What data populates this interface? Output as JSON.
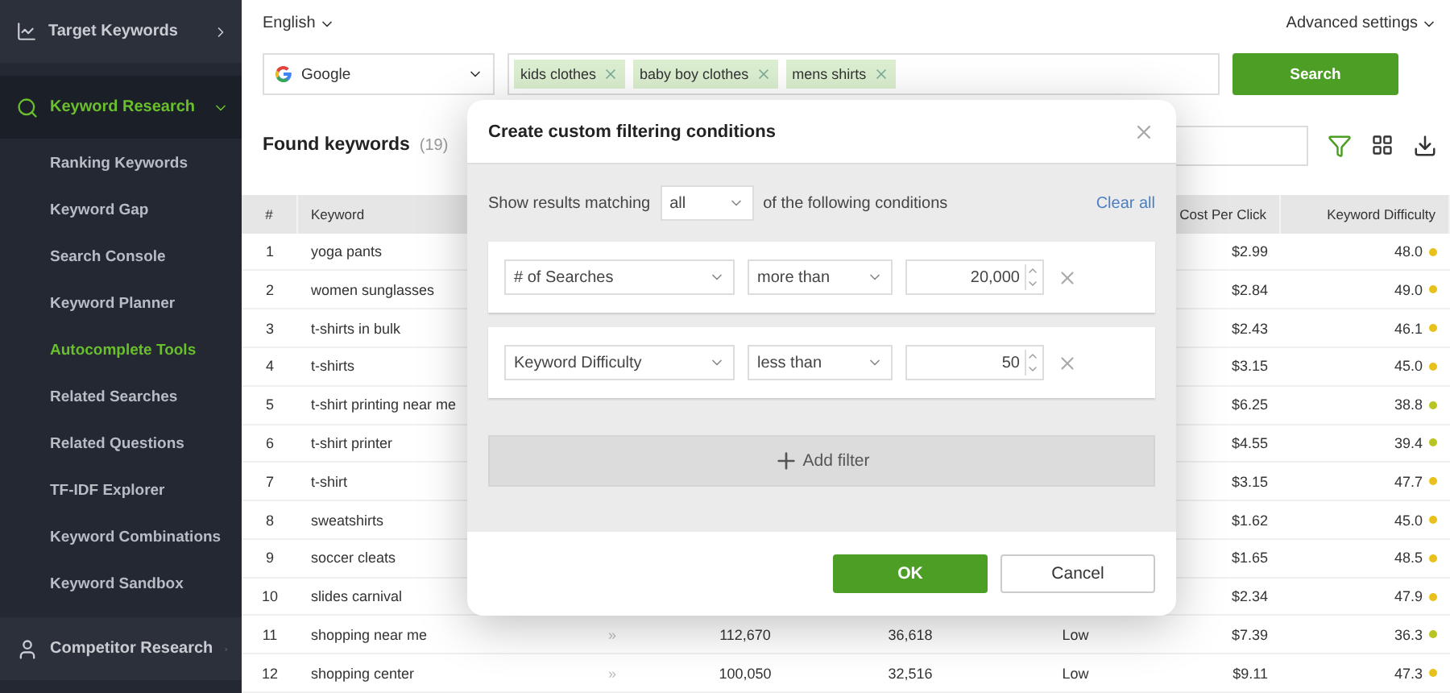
{
  "sidebar": {
    "sections": [
      {
        "label": "Target Keywords",
        "expanded": false,
        "selected": false
      },
      {
        "label": "Keyword Research",
        "expanded": true,
        "selected": true,
        "children": [
          {
            "label": "Ranking Keywords",
            "selected": false
          },
          {
            "label": "Keyword Gap",
            "selected": false
          },
          {
            "label": "Search Console",
            "selected": false
          },
          {
            "label": "Keyword Planner",
            "selected": false
          },
          {
            "label": "Autocomplete Tools",
            "selected": true
          },
          {
            "label": "Related Searches",
            "selected": false
          },
          {
            "label": "Related Questions",
            "selected": false
          },
          {
            "label": "TF-IDF Explorer",
            "selected": false
          },
          {
            "label": "Keyword Combinations",
            "selected": false
          },
          {
            "label": "Keyword Sandbox",
            "selected": false
          }
        ]
      },
      {
        "label": "Competitor Research",
        "expanded": false,
        "selected": false
      }
    ]
  },
  "language": "English",
  "advanced_settings": "Advanced settings",
  "engine": "Google",
  "keywords": [
    "kids clothes",
    "baby boy clothes",
    "mens shirts"
  ],
  "search_button": "Search",
  "found": {
    "title": "Found keywords",
    "count": "(19)"
  },
  "table": {
    "columns": [
      "#",
      "Keyword",
      "Cost Per Click",
      "Keyword Difficulty"
    ],
    "rows": [
      {
        "n": "1",
        "keyword": "yoga pants",
        "cpc": "$2.99",
        "kd": "48.0",
        "color": "#e8c21a"
      },
      {
        "n": "2",
        "keyword": "women sunglasses",
        "cpc": "$2.84",
        "kd": "49.0",
        "color": "#e8c21a"
      },
      {
        "n": "3",
        "keyword": "t-shirts in bulk",
        "cpc": "$2.43",
        "kd": "46.1",
        "color": "#e8c21a"
      },
      {
        "n": "4",
        "keyword": "t-shirts",
        "cpc": "$3.15",
        "kd": "45.0",
        "color": "#e8c21a"
      },
      {
        "n": "5",
        "keyword": "t-shirt printing near me",
        "cpc": "$6.25",
        "kd": "38.8",
        "color": "#b9c421"
      },
      {
        "n": "6",
        "keyword": "t-shirt printer",
        "cpc": "$4.55",
        "kd": "39.4",
        "color": "#b9c421"
      },
      {
        "n": "7",
        "keyword": "t-shirt",
        "cpc": "$3.15",
        "kd": "47.7",
        "color": "#e8c21a"
      },
      {
        "n": "8",
        "keyword": "sweatshirts",
        "cpc": "$1.62",
        "kd": "45.0",
        "color": "#e8c21a"
      },
      {
        "n": "9",
        "keyword": "soccer cleats",
        "cpc": "$1.65",
        "kd": "48.5",
        "color": "#e8c21a"
      },
      {
        "n": "10",
        "keyword": "slides carnival",
        "cpc": "$2.34",
        "kd": "47.9",
        "color": "#e8c21a"
      },
      {
        "n": "11",
        "keyword": "shopping near me",
        "arrows": "»",
        "column_4": "112,670",
        "column_5": "36,618",
        "column_6": "Low",
        "cpc": "$7.39",
        "kd": "36.3",
        "color": "#b9c421"
      },
      {
        "n": "12",
        "keyword": "shopping center",
        "arrows": "»",
        "column_4": "100,050",
        "column_5": "32,516",
        "column_6": "Low",
        "cpc": "$9.11",
        "kd": "47.3",
        "color": "#e8c21a"
      }
    ]
  },
  "dialog": {
    "title": "Create custom filtering conditions",
    "match_prefix": "Show results matching",
    "match_value": "all",
    "match_suffix": "of the following conditions",
    "clear_all": "Clear all",
    "filters": [
      {
        "field": "# of Searches",
        "operator": "more than",
        "value": "20,000"
      },
      {
        "field": "Keyword Difficulty",
        "operator": "less than",
        "value": "50"
      }
    ],
    "add_filter": "Add filter",
    "ok": "OK",
    "cancel": "Cancel"
  }
}
